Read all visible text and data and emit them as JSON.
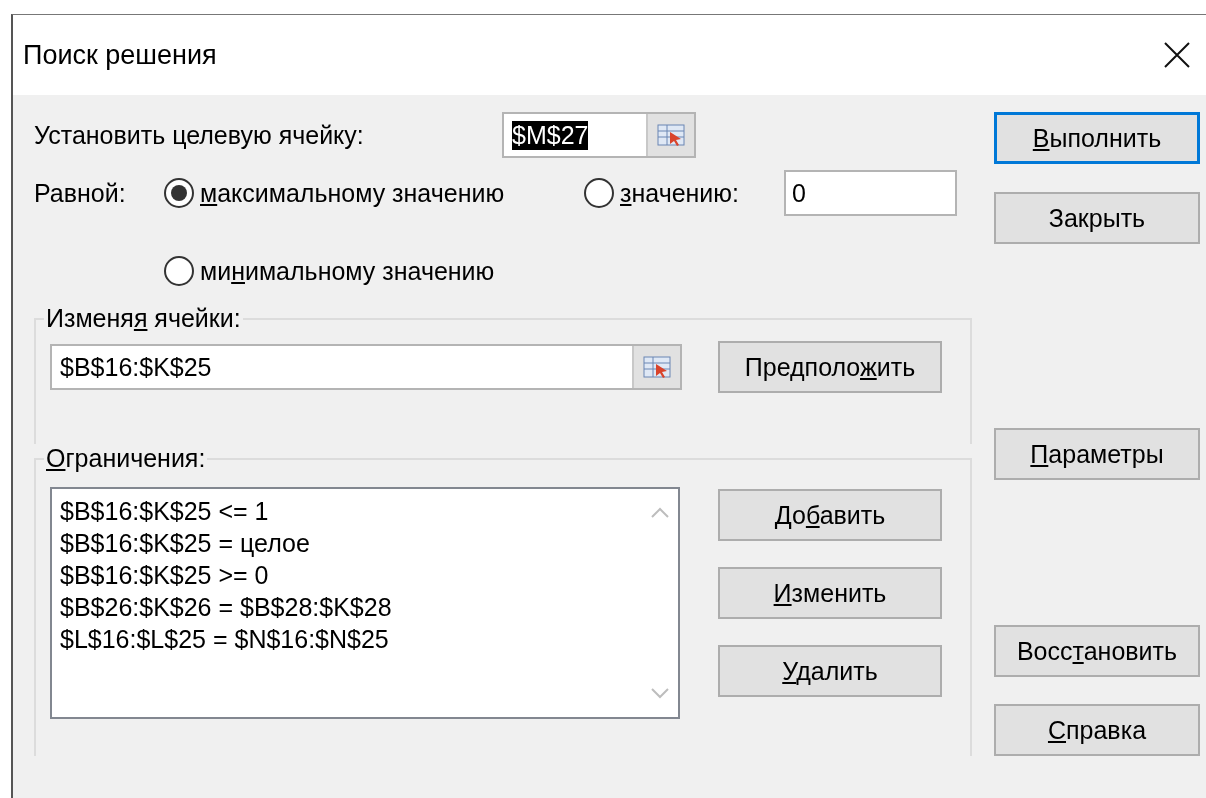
{
  "window": {
    "title": "Поиск решения"
  },
  "target": {
    "label": {
      "pre": "Установить целевую ячейку:"
    },
    "value": "$M$27",
    "text_selected": true
  },
  "equal_to": {
    "label": {
      "pre": "Равной:"
    },
    "options": [
      {
        "label": {
          "key": "м",
          "post": "аксимальному значению"
        },
        "selected": true
      },
      {
        "label": {
          "key": "з",
          "post": "начению:"
        },
        "selected": false
      },
      {
        "label": {
          "pre": "ми",
          "key": "н",
          "post": "имальному значению"
        },
        "selected": false
      }
    ],
    "value": "0"
  },
  "changing_cells": {
    "label": {
      "pre": "Изменя",
      "key": "я",
      "post": " ячейки:"
    },
    "value": "$B$16:$K$25",
    "guess_button": {
      "pre": "Предполо",
      "key": "ж",
      "post": "ить"
    }
  },
  "constraints": {
    "label": {
      "key": "О",
      "post": "граничения:"
    },
    "items": [
      "$B$16:$K$25 <= 1",
      "$B$16:$K$25 = целое",
      "$B$16:$K$25 >= 0",
      "$B$26:$K$26 = $B$28:$K$28",
      "$L$16:$L$25 = $N$16:$N$25"
    ],
    "buttons": [
      {
        "pre": "До",
        "key": "б",
        "post": "авить"
      },
      {
        "key": "И",
        "post": "зменить"
      },
      {
        "key": "У",
        "post": "далить"
      }
    ]
  },
  "side_buttons": [
    {
      "label": {
        "key": "В",
        "post": "ыполнить"
      },
      "default": true
    },
    {
      "label": {
        "pre": "Закрыть"
      },
      "default": false
    },
    {
      "label": {
        "key": "П",
        "post": "араметры"
      },
      "default": false
    },
    {
      "label": {
        "pre": "Восс",
        "key": "т",
        "post": "ановить"
      },
      "default": false
    },
    {
      "label": {
        "key": "С",
        "post": "правка"
      },
      "default": false
    }
  ]
}
